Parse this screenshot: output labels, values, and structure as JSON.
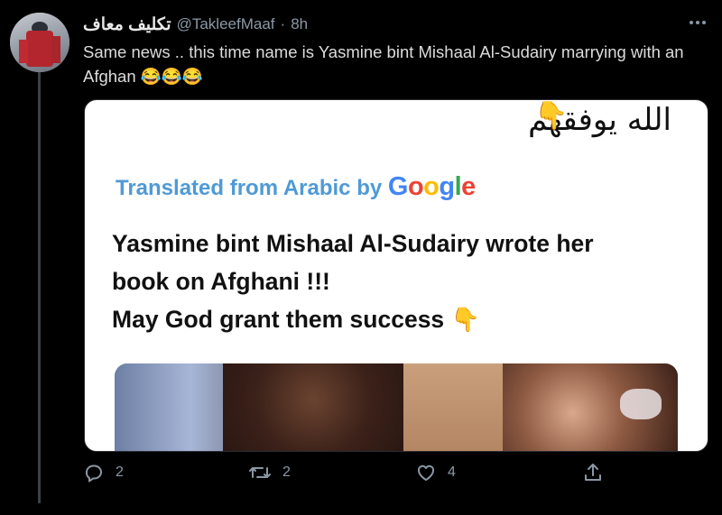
{
  "tweet": {
    "display_name": "تكليف معاف",
    "handle": "@TakleefMaaf",
    "separator": "·",
    "time": "8h",
    "text": "Same news .. this time name is Yasmine bint Mishaal Al-Sudairy marrying with an Afghan 😂😂😂",
    "more_icon": "more-horizontal-icon"
  },
  "media": {
    "arabic_caption": "الله يوفقهم",
    "pointing_emoji": "👇",
    "translated_prefix": "Translated from Arabic by",
    "google_letters": [
      "G",
      "o",
      "o",
      "g",
      "l",
      "e"
    ],
    "translation_lines": [
      "Yasmine bint Mishaal Al-Sudairy wrote her",
      "book on Afghani !!!",
      " May God grant them success"
    ],
    "translation_emoji": "👇"
  },
  "actions": {
    "reply_count": "2",
    "retweet_count": "2",
    "like_count": "4",
    "icons": [
      "reply-icon",
      "retweet-icon",
      "like-icon",
      "share-icon"
    ]
  },
  "colors": {
    "background": "#000000",
    "muted": "#8b98a5",
    "translated_blue": "#4f9ad6"
  }
}
